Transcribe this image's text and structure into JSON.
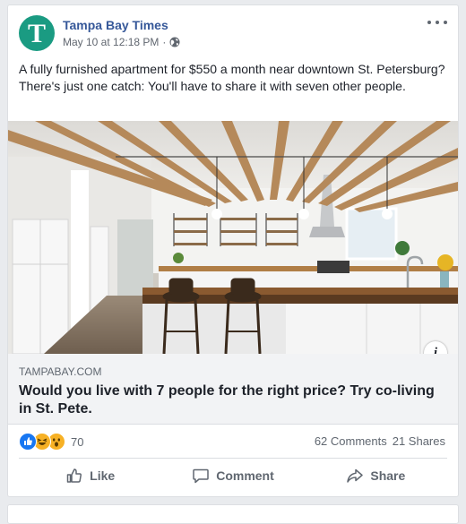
{
  "post": {
    "page_name": "Tampa Bay Times",
    "logo_letter": "T",
    "timestamp": "May 10 at 12:18 PM",
    "separator": "·",
    "text": "A fully furnished apartment for $550 a month near downtown St. Petersburg? There's just one catch: You'll have to share it with seven other people."
  },
  "link": {
    "domain": "TAMPABAY.COM",
    "headline": "Would you live with 7 people for the right price? Try co-living in St. Pete.",
    "info_glyph": "i"
  },
  "engagement": {
    "reaction_count": "70",
    "comments": "62 Comments",
    "shares": "21 Shares"
  },
  "actions": {
    "like": "Like",
    "comment": "Comment",
    "share": "Share"
  },
  "colors": {
    "brand_teal": "#1a9b82",
    "link_blue": "#365899",
    "like_blue": "#1877f2",
    "reaction_yellow": "#f7b125"
  }
}
